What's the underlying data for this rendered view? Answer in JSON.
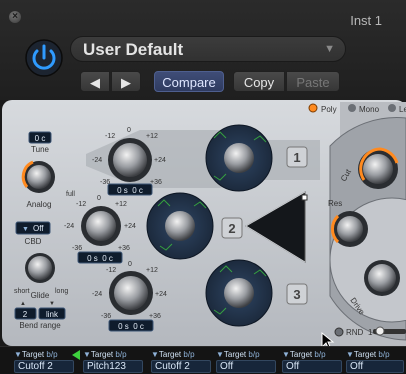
{
  "window": {
    "title": "Inst 1"
  },
  "header": {
    "preset_name": "User Default",
    "prev_label": "◀",
    "next_label": "▶",
    "compare_label": "Compare",
    "copy_label": "Copy",
    "paste_label": "Paste"
  },
  "voice_mode": {
    "options": [
      "Poly",
      "Mono",
      "Le"
    ],
    "selected": "Poly"
  },
  "left_controls": {
    "tune": {
      "value": "0 c",
      "label": "Tune"
    },
    "analog": {
      "label": "Analog",
      "full_label": "full"
    },
    "cbd": {
      "value": "Off",
      "label": "CBD"
    },
    "glide": {
      "label": "Glide",
      "short_label": "short",
      "long_label": "long"
    },
    "bend": {
      "down": "2",
      "link": "link",
      "label": "Bend range"
    }
  },
  "oscillators": [
    {
      "number": "1",
      "scale": [
        "-12",
        "0",
        "+12",
        "-24",
        "+24",
        "-36",
        "+36"
      ],
      "readout": "0 s  0 c"
    },
    {
      "number": "2",
      "scale": [
        "-12",
        "0",
        "+12",
        "-24",
        "+24",
        "-36",
        "+36"
      ],
      "readout": "0 s  0 c"
    },
    {
      "number": "3",
      "scale": [
        "-12",
        "0",
        "+12",
        "-24",
        "+24",
        "-36",
        "+36"
      ],
      "readout": "0 s  0 c"
    }
  ],
  "filter_labels": {
    "cut": "Cut",
    "res": "Res",
    "drive": "Drive"
  },
  "rnd": {
    "label": "RND",
    "value": "1"
  },
  "mod_slots": [
    {
      "target_label": "Target",
      "bp": "b/p",
      "value": "Cutoff 2"
    },
    {
      "target_label": "Target",
      "bp": "b/p",
      "value": "Pitch123"
    },
    {
      "target_label": "Target",
      "bp": "b/p",
      "value": "Cutoff 2"
    },
    {
      "target_label": "Target",
      "bp": "b/p",
      "value": "Off"
    },
    {
      "target_label": "Target",
      "bp": "b/p",
      "value": "Off"
    },
    {
      "target_label": "Target",
      "bp": "b/p",
      "value": "Off"
    }
  ],
  "colors": {
    "accent_blue": "#2f9bff",
    "compare_blue": "#3f4d77",
    "led_orange": "#ff8a1f",
    "panel_silver": "#c9ccd1",
    "osc_blue": "#22324a"
  },
  "icons": [
    "close-icon",
    "power-icon",
    "chevron-down-icon",
    "triangle-left-icon",
    "triangle-right-icon",
    "cursor-icon"
  ]
}
